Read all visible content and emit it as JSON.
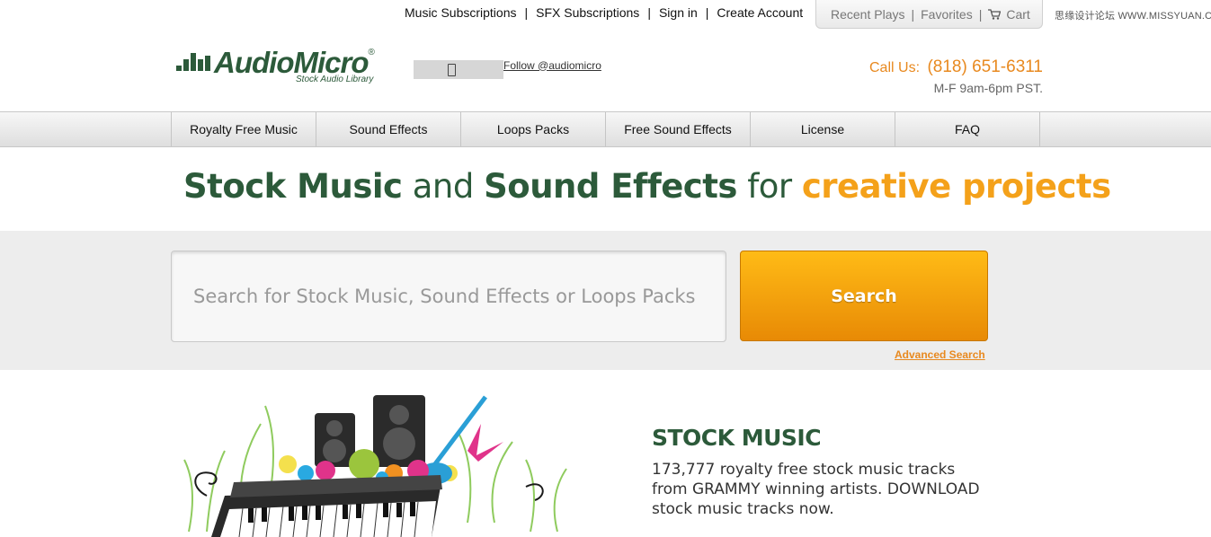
{
  "top_links": {
    "music_subscriptions": "Music Subscriptions",
    "sfx_subscriptions": "SFX Subscriptions",
    "sign_in": "Sign in",
    "create_account": "Create Account",
    "separator": "|"
  },
  "user_box": {
    "recent_plays": "Recent Plays",
    "favorites": "Favorites",
    "cart": "Cart",
    "separator": "|"
  },
  "watermark": "思缘设计论坛 WWW.MISSYUAN.COM",
  "logo": {
    "name": "AudioMicro",
    "registered": "®",
    "tagline": "Stock Audio Library"
  },
  "follow": {
    "label": "Follow @audiomicro"
  },
  "contact": {
    "call_label": "Call Us:",
    "phone": "(818) 651-6311",
    "hours": "M-F 9am-6pm PST."
  },
  "nav": {
    "items": [
      "Royalty Free Music",
      "Sound Effects",
      "Loops Packs",
      "Free Sound Effects",
      "License",
      "FAQ"
    ]
  },
  "headline": {
    "part1": "Stock Music",
    "part2": " and ",
    "part3": "Sound Effects",
    "part4": " for ",
    "part5": "creative projects"
  },
  "search": {
    "placeholder": "Search for Stock Music, Sound Effects or Loops Packs",
    "button": "Search",
    "advanced": "Advanced Search"
  },
  "stock_music": {
    "title": "STOCK MUSIC",
    "description": "173,777 royalty free stock music tracks from GRAMMY winning artists. DOWNLOAD stock music tracks now."
  },
  "colors": {
    "brand_green": "#2c5a3a",
    "accent_orange": "#f4a11a",
    "search_button": "#f5a20f"
  }
}
